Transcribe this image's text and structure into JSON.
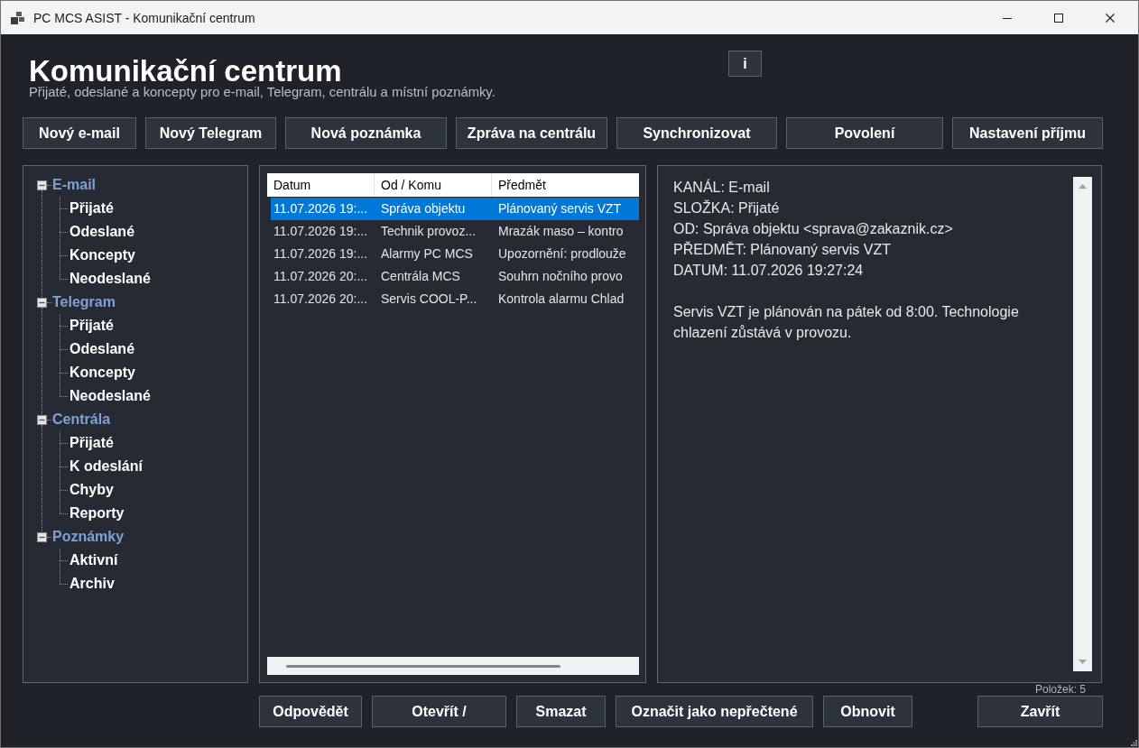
{
  "window": {
    "title": "PC MCS ASIST - Komunikační centrum"
  },
  "header": {
    "title": "Komunikační centrum",
    "subtitle": "Přijaté, odeslané a koncepty pro e-mail, Telegram, centrálu a místní poznámky.",
    "info_button": "i"
  },
  "toolbar": [
    "Nový e-mail",
    "Nový Telegram",
    "Nová poznámka",
    "Zpráva na centrálu",
    "Synchronizovat",
    "Povolení",
    "Nastavení příjmu"
  ],
  "folders": [
    {
      "label": "E-mail",
      "expanded": true,
      "children": [
        {
          "label": "Přijaté"
        },
        {
          "label": "Odeslané"
        },
        {
          "label": "Koncepty"
        },
        {
          "label": "Neodeslané"
        }
      ]
    },
    {
      "label": "Telegram",
      "expanded": true,
      "children": [
        {
          "label": "Přijaté"
        },
        {
          "label": "Odeslané"
        },
        {
          "label": "Koncepty"
        },
        {
          "label": "Neodeslané"
        }
      ]
    },
    {
      "label": "Centrála",
      "expanded": true,
      "children": [
        {
          "label": "Přijaté"
        },
        {
          "label": "K odeslání"
        },
        {
          "label": "Chyby"
        },
        {
          "label": "Reporty"
        }
      ]
    },
    {
      "label": "Poznámky",
      "expanded": true,
      "children": [
        {
          "label": "Aktivní"
        },
        {
          "label": "Archiv"
        }
      ]
    }
  ],
  "messages": {
    "columns": [
      "Datum",
      "Od / Komu",
      "Předmět"
    ],
    "rows": [
      {
        "cells": [
          "11.07.2026 19:...",
          "Správa objektu",
          "Plánovaný servis VZT"
        ],
        "selected": true
      },
      {
        "cells": [
          "11.07.2026 19:...",
          "Technik provoz...",
          "Mrazák maso – kontro"
        ],
        "selected": false
      },
      {
        "cells": [
          "11.07.2026 19:...",
          "Alarmy PC MCS",
          "Upozornění: prodlouže"
        ],
        "selected": false
      },
      {
        "cells": [
          "11.07.2026 20:...",
          "Centrála MCS",
          "Souhrn nočního provo"
        ],
        "selected": false
      },
      {
        "cells": [
          "11.07.2026 20:...",
          "Servis COOL-P...",
          "Kontrola alarmu Chlad"
        ],
        "selected": false
      }
    ]
  },
  "preview": {
    "fields": [
      "KANÁL: E-mail",
      "SLOŽKA: Přijaté",
      "OD: Správa objektu <sprava@zakaznik.cz>",
      "PŘEDMĚT: Plánovaný servis VZT",
      "DATUM: 11.07.2026 19:27:24"
    ],
    "body": "Servis VZT je plánován na pátek od 8:00. Technologie chlazení zůstává v provozu."
  },
  "item_count": "Položek: 5",
  "actions": [
    "Odpovědět",
    "Otevřít /",
    "Smazat",
    "Označit jako nepřečtené",
    "Obnovit"
  ],
  "close_button": "Zavřít"
}
